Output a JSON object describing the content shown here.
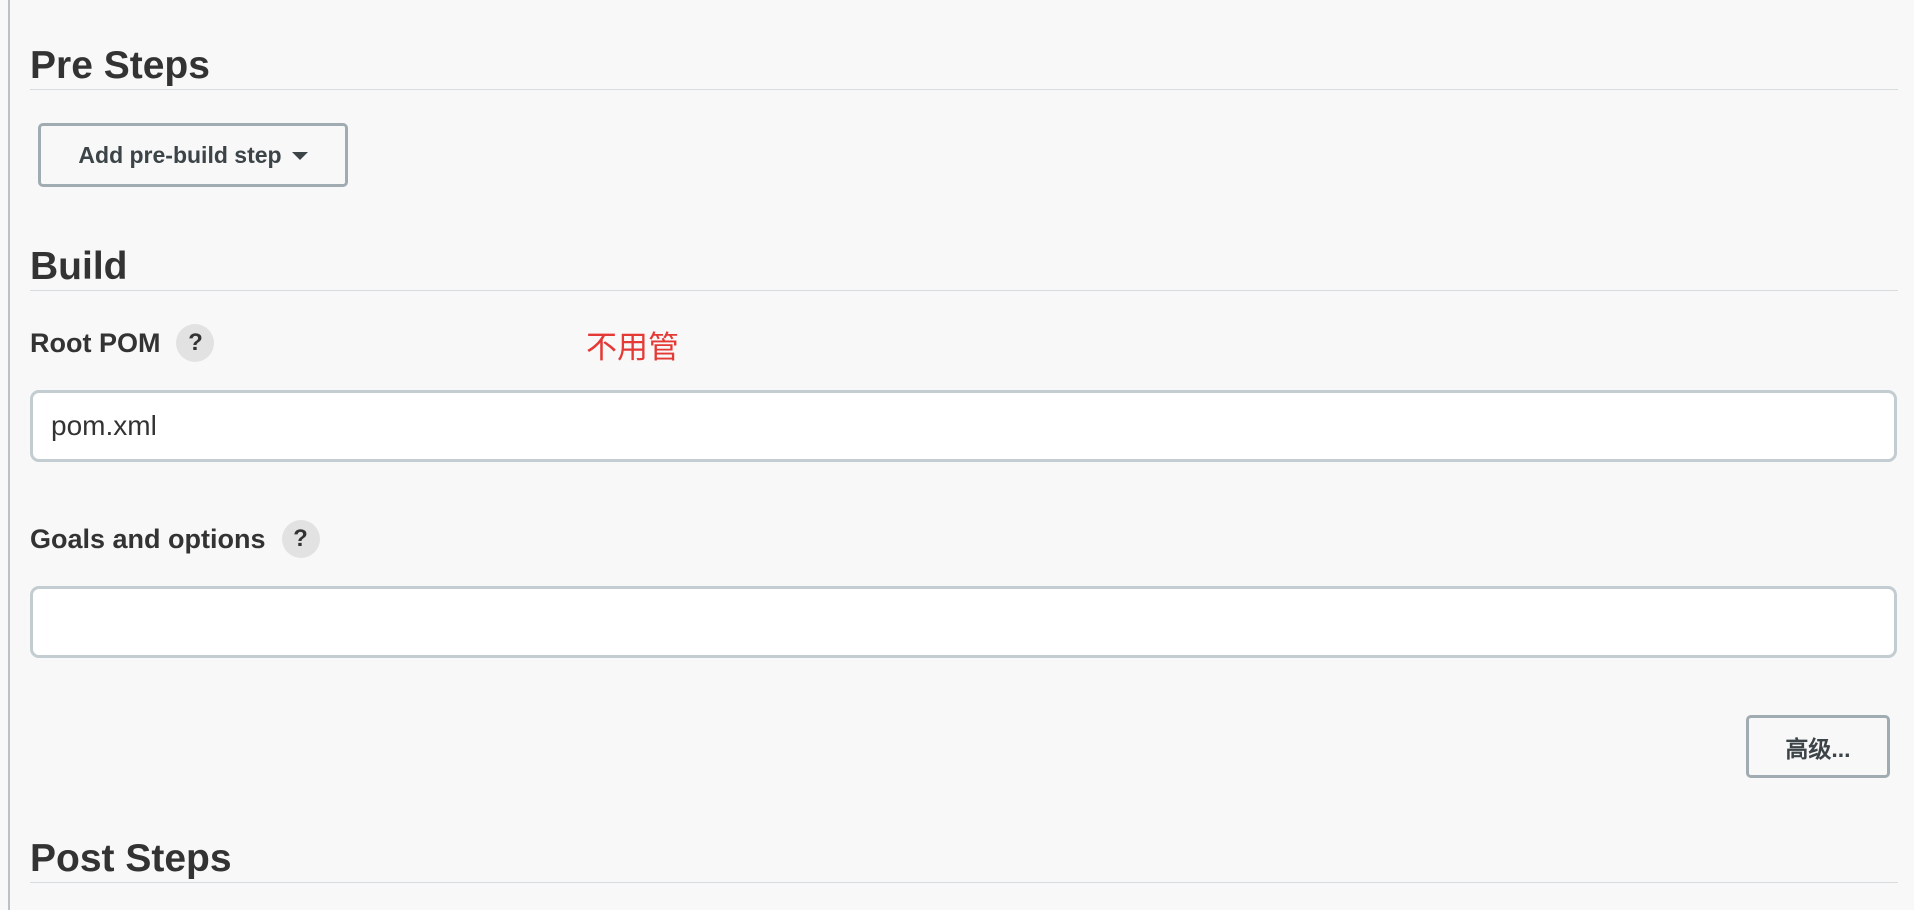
{
  "sections": {
    "pre_steps": {
      "title": "Pre Steps",
      "add_button_label": "Add pre-build step"
    },
    "build": {
      "title": "Build",
      "root_pom": {
        "label": "Root POM",
        "help": "?",
        "value": "pom.xml",
        "annotation": "不用管"
      },
      "goals": {
        "label": "Goals and options",
        "help": "?",
        "value": ""
      },
      "advanced_button_label": "高级..."
    },
    "post_steps": {
      "title": "Post Steps"
    }
  },
  "colors": {
    "background": "#f8f8f8",
    "annotation": "#e53935",
    "button_border": "#a0acb2",
    "input_border": "#c3cdd1"
  }
}
